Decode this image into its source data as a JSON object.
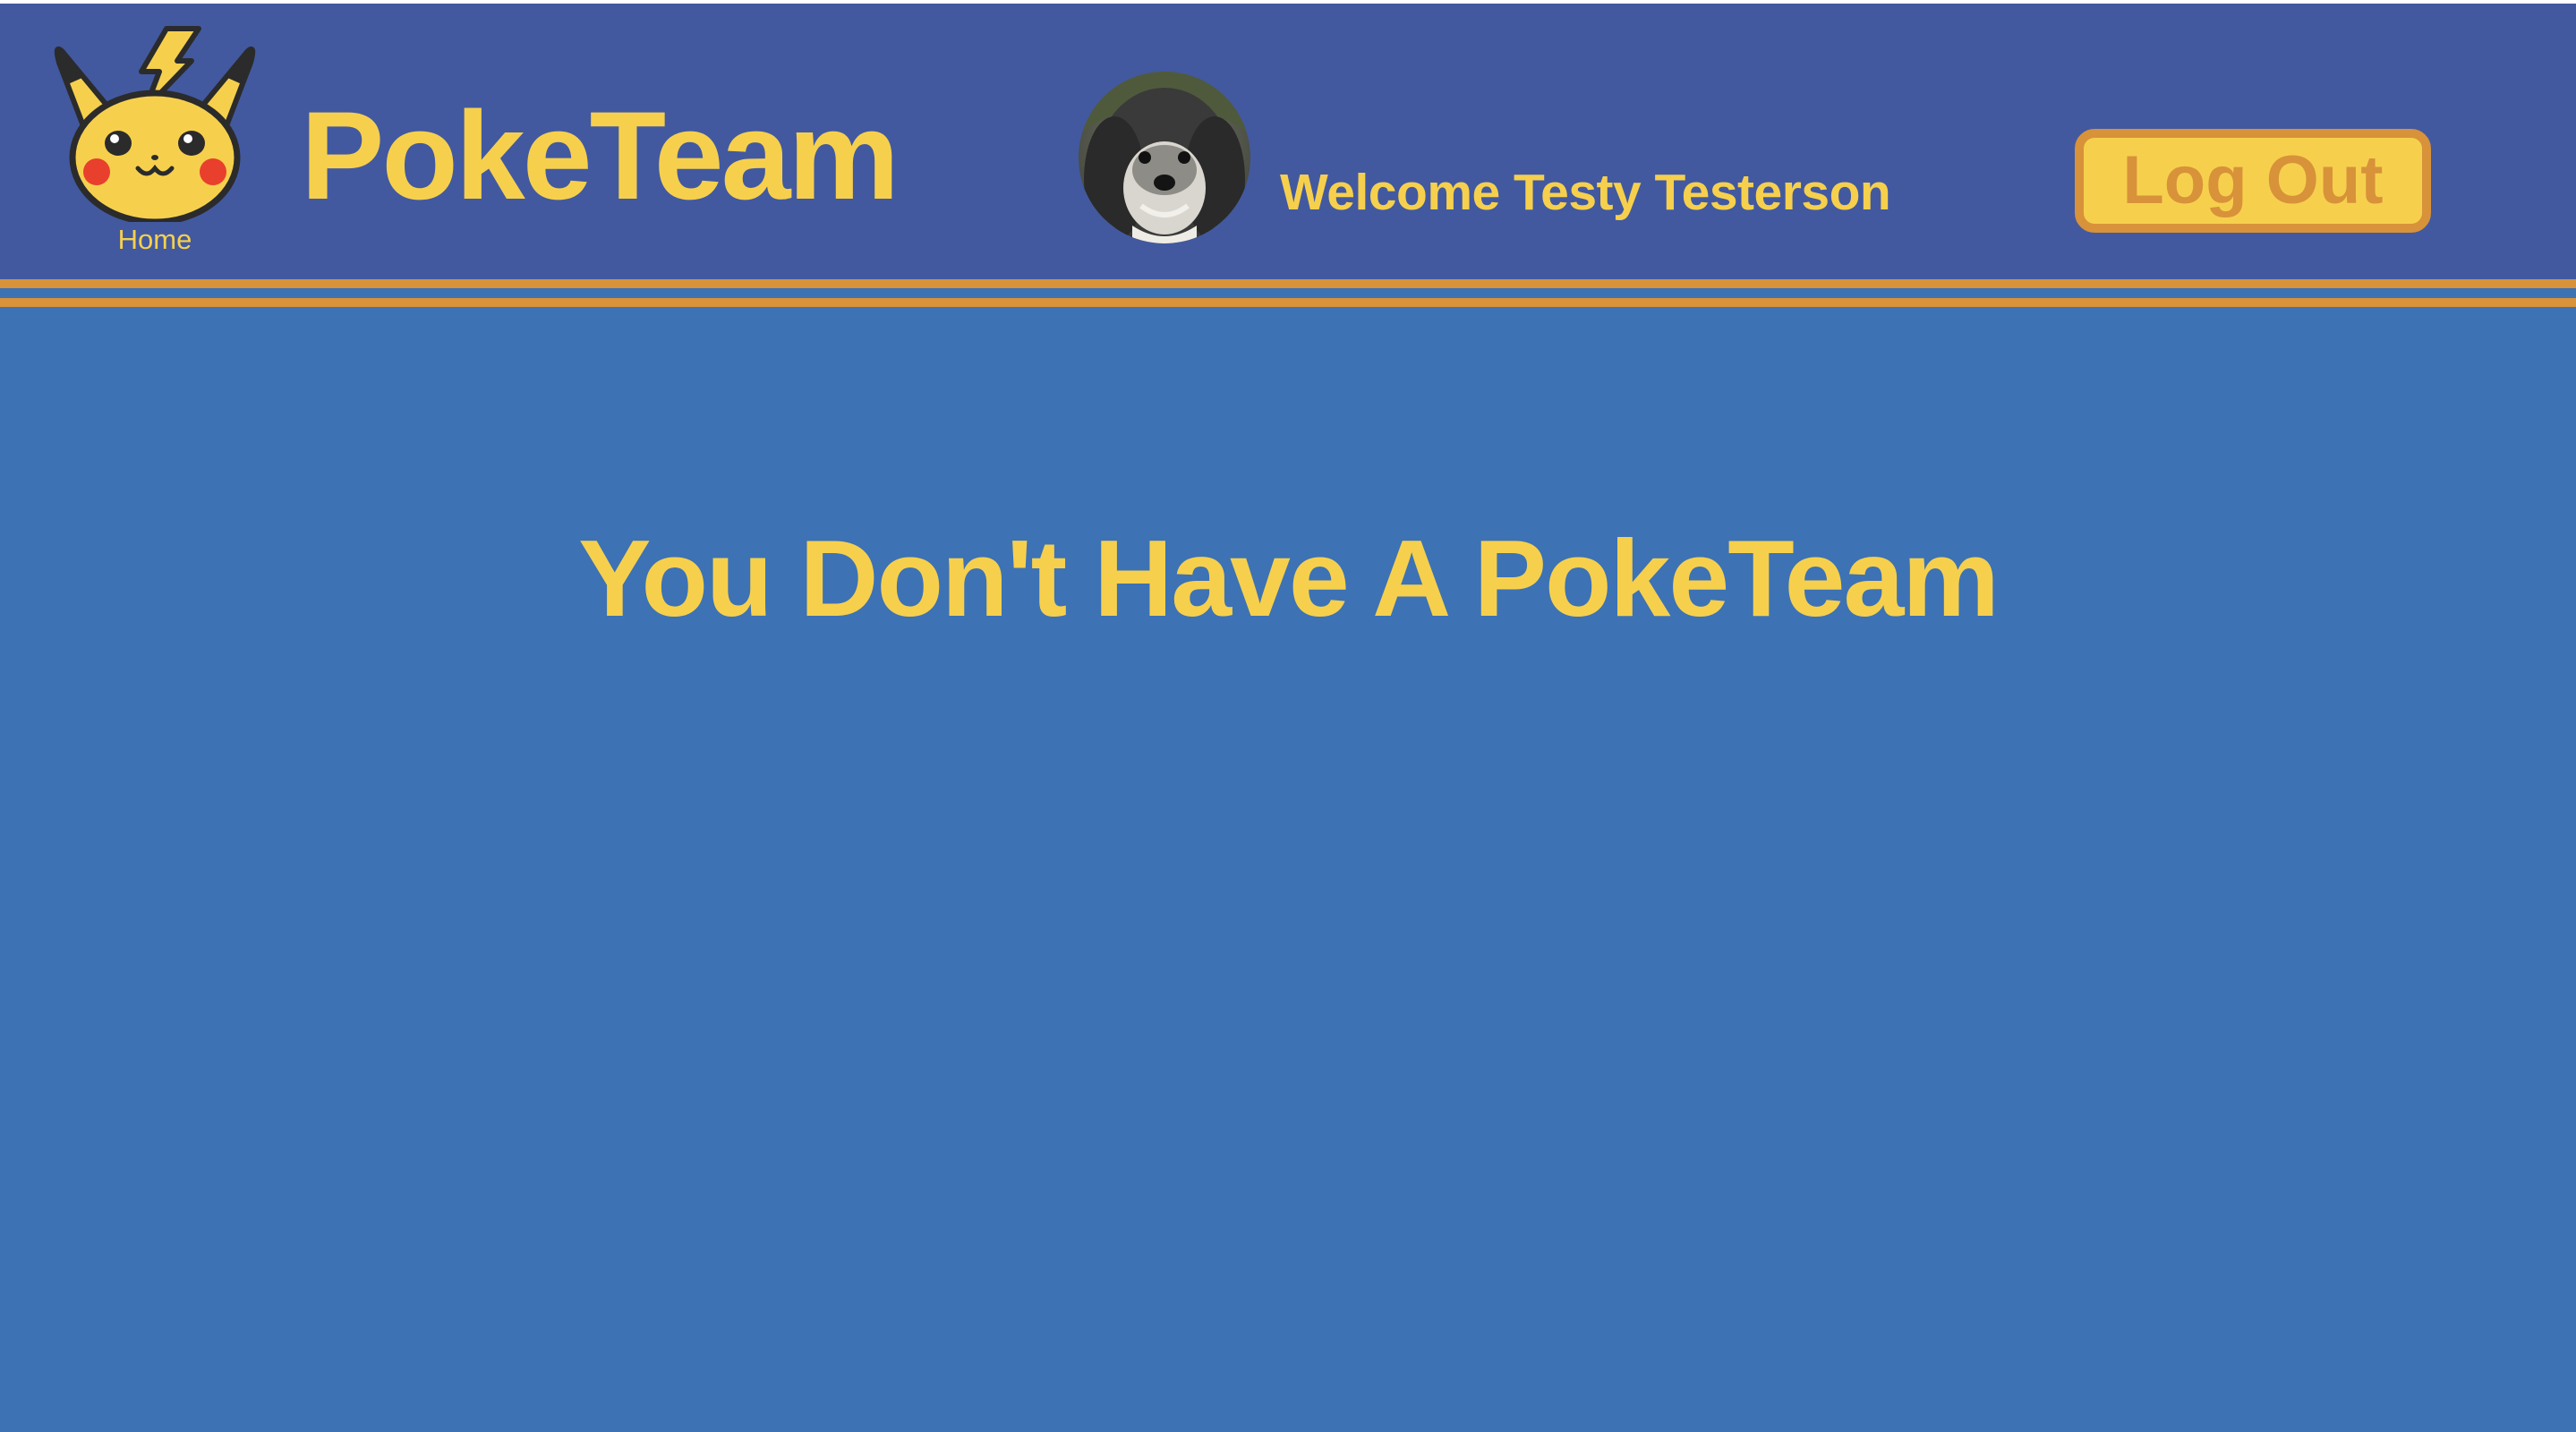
{
  "header": {
    "home_label": "Home",
    "brand_title": "PokeTeam",
    "welcome_text": "Welcome Testy Testerson",
    "logout_label": "Log Out",
    "logo_icon": "pikachu-face-icon",
    "avatar_icon": "dog-avatar"
  },
  "main": {
    "message": "You Don't Have A PokeTeam"
  },
  "colors": {
    "header_bg": "#4259a0",
    "page_bg": "#3d72b4",
    "accent_yellow": "#f6d04d",
    "accent_orange": "#d8923a"
  }
}
